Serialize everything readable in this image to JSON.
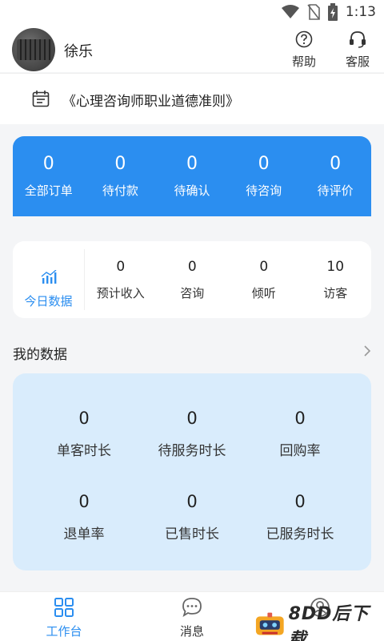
{
  "status_bar": {
    "time": "1:13"
  },
  "header": {
    "username": "徐乐",
    "help_label": "帮助",
    "service_label": "客服"
  },
  "notice": {
    "text": "《心理咨询师职业道德准则》"
  },
  "orders": [
    {
      "count": "0",
      "label": "全部订单"
    },
    {
      "count": "0",
      "label": "待付款"
    },
    {
      "count": "0",
      "label": "待确认"
    },
    {
      "count": "0",
      "label": "待咨询"
    },
    {
      "count": "0",
      "label": "待评价"
    }
  ],
  "today": {
    "tab_label": "今日数据",
    "items": [
      {
        "value": "0",
        "label": "预计收入"
      },
      {
        "value": "0",
        "label": "咨询"
      },
      {
        "value": "0",
        "label": "倾听"
      },
      {
        "value": "10",
        "label": "访客"
      }
    ]
  },
  "my_data": {
    "title": "我的数据",
    "items": [
      {
        "value": "0",
        "label": "单客时长"
      },
      {
        "value": "0",
        "label": "待服务时长"
      },
      {
        "value": "0",
        "label": "回购率"
      },
      {
        "value": "0",
        "label": "退单率"
      },
      {
        "value": "0",
        "label": "已售时长"
      },
      {
        "value": "0",
        "label": "已服务时长"
      }
    ]
  },
  "tabbar": [
    {
      "label": "工作台",
      "icon": "grid-icon",
      "active": true
    },
    {
      "label": "消息",
      "icon": "chat-icon",
      "active": false
    },
    {
      "label": "",
      "icon": "user-icon",
      "active": false
    }
  ],
  "watermark": {
    "text": "8DD后下载"
  },
  "colors": {
    "accent": "#2b8ef0",
    "data_card_bg": "#d9ecfc",
    "page_bg": "#f4f5f7"
  }
}
